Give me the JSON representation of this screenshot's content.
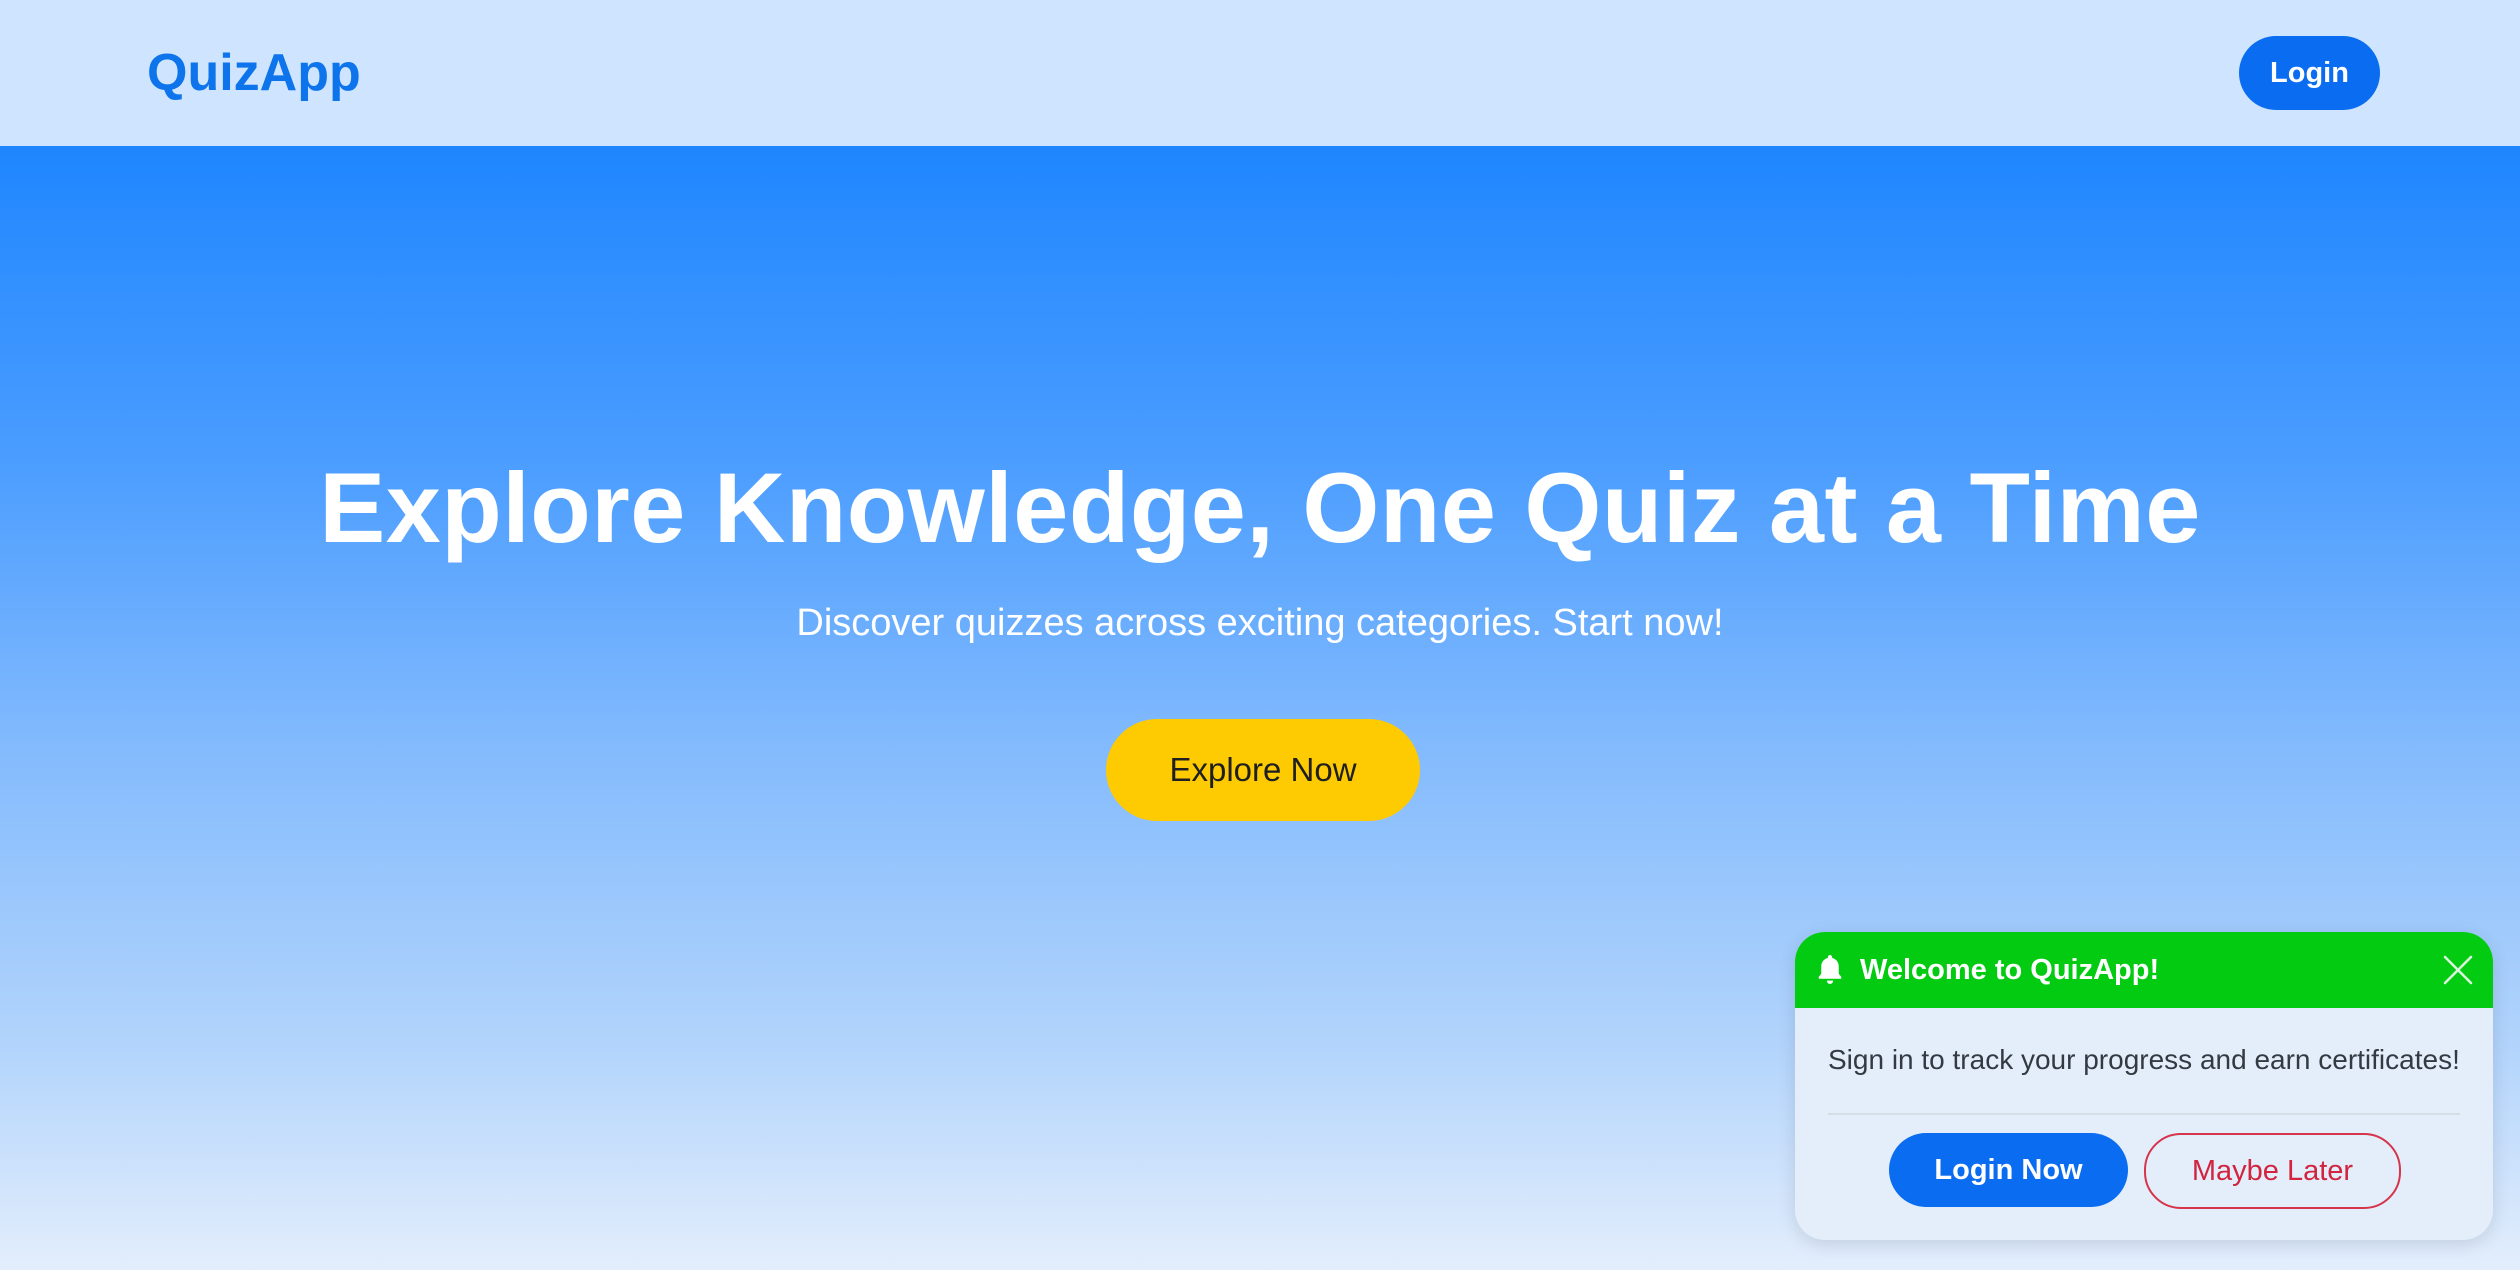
{
  "navbar": {
    "brand": "QuizApp",
    "login_label": "Login"
  },
  "hero": {
    "title": "Explore Knowledge, One Quiz at a Time",
    "subtitle": "Discover quizzes across exciting categories. Start now!",
    "cta_label": "Explore Now"
  },
  "popup": {
    "icon": "bell-icon",
    "title": "Welcome to QuizApp!",
    "close_icon": "close-icon",
    "message": "Sign in to track your progress and earn certificates!",
    "primary_label": "Login Now",
    "secondary_label": "Maybe Later"
  },
  "colors": {
    "brand": "#0d74ec",
    "primary_button": "#0a6cf0",
    "cta_button": "#fecb02",
    "popup_header": "#02cb12",
    "danger": "#d0243f"
  }
}
